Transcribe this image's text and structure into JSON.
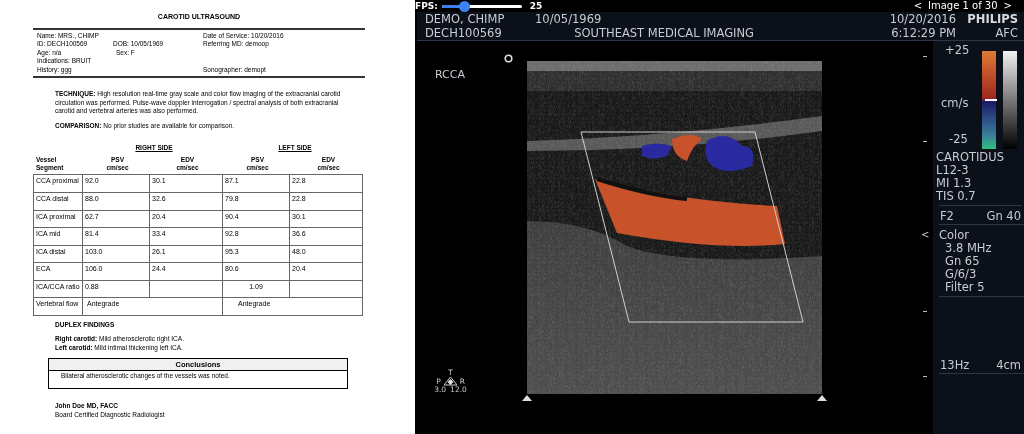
{
  "report": {
    "title": "CAROTID ULTRASOUND",
    "header_left": [
      "Name: MRS., CHIMP",
      "ID: DECH100569",
      "Age: n/a",
      "Indications: BRUIT",
      "History: ggg"
    ],
    "header_middle": [
      "DOB: 10/05/1969",
      "Sex: F"
    ],
    "header_right": [
      "Date of Service: 10/20/2016",
      "Referring MD:  demoop",
      "Sonographer:  demopt"
    ],
    "technique": "**TECHNIQUE:** High resolution real-time gray scale and color flow imaging of the extracranial carotid circulation was performed. Pulse-wave doppler interrogation / spectral analysis of both extracranial carotid and vertebral arteries was also performed.",
    "comparison": "**COMPARISON:** No prior studies are available for comparison.",
    "table": {
      "sides": [
        "RIGHT SIDE",
        "LEFT SIDE"
      ],
      "header_rows": [
        [
          "Vessel",
          "PSV",
          "EDV",
          "PSV",
          "EDV"
        ],
        [
          "Segment",
          "cm/sec",
          "cm/sec",
          "cm/sec",
          "cm/sec"
        ]
      ],
      "rows": [
        {
          "kind": "values",
          "cells": [
            "CCA proximal",
            "92.0",
            "30.1",
            "87.1",
            "22.8"
          ]
        },
        {
          "kind": "values",
          "cells": [
            "CCA distal",
            "88.0",
            "32.6",
            "79.8",
            "22.8"
          ]
        },
        {
          "kind": "values",
          "cells": [
            "ICA proximal",
            "62.7",
            "20.4",
            "90.4",
            "30.1"
          ]
        },
        {
          "kind": "values",
          "cells": [
            "ICA mid",
            "81.4",
            "33.4",
            "92.8",
            "36.6"
          ]
        },
        {
          "kind": "values",
          "cells": [
            "ICA distal",
            "103.0",
            "26.1",
            "95.3",
            "48.0"
          ]
        },
        {
          "kind": "values",
          "cells": [
            "ECA",
            "106.0",
            "24.4",
            "80.6",
            "20.4"
          ]
        },
        {
          "kind": "ratio",
          "cells": [
            "ICA/CCA ratio",
            "0.88",
            "1.09"
          ]
        },
        {
          "kind": "flow",
          "cells": [
            "Vertebral flow",
            "Antegrade",
            "Antegrade"
          ]
        }
      ]
    },
    "duplex_heading": "DUPLEX FINDINGS",
    "findings": [
      "**Right carotid:** Mild atherosclerotic right ICA.",
      "**Left carotid:** Mild intimal thickening left ICA."
    ],
    "conclusions": {
      "title": "Conclusions",
      "text": "Bilateral atherosclerotic changes of the vessels was noted."
    },
    "signature": {
      "name": "John Doe MD, FACC",
      "title": "Board Certified Diagnostic Radiologist"
    }
  },
  "viewer": {
    "fps": {
      "label": "FPS:",
      "value": "25",
      "level": 0.28
    },
    "pager": {
      "prev": "<",
      "label": "Image 1 of 30",
      "next": ">"
    },
    "header": {
      "patient_name": "DEMO, CHIMP",
      "dob": "10/05/1969",
      "date": "10/20/2016",
      "brand": "PHILIPS",
      "patient_id": "DECH100569",
      "facility": "SOUTHEAST MEDICAL IMAGING",
      "time": "6:12:29 PM",
      "mode": "AFC"
    },
    "image": {
      "label": "RCCA",
      "orientation": {
        "top": "T",
        "left": "P",
        "right": "R",
        "depth_min": "3.0",
        "depth_max": "12.0"
      }
    },
    "scale": {
      "max": "+25",
      "unit": "cm/s",
      "min": "-25"
    },
    "params": [
      {
        "kind": "lines",
        "lines": [
          "CAROTIDUS",
          "L12-3",
          "MI 1.3",
          "TIS 0.7"
        ]
      },
      {
        "kind": "pair",
        "left": "F2",
        "right": "Gn 40"
      },
      {
        "kind": "nested",
        "marker": "<",
        "title": "Color",
        "children": [
          "3.8 MHz",
          "Gn 65",
          "G/6/3",
          "Filter 5"
        ]
      },
      {
        "kind": "footer",
        "left": "13Hz",
        "right": "4cm"
      }
    ]
  }
}
